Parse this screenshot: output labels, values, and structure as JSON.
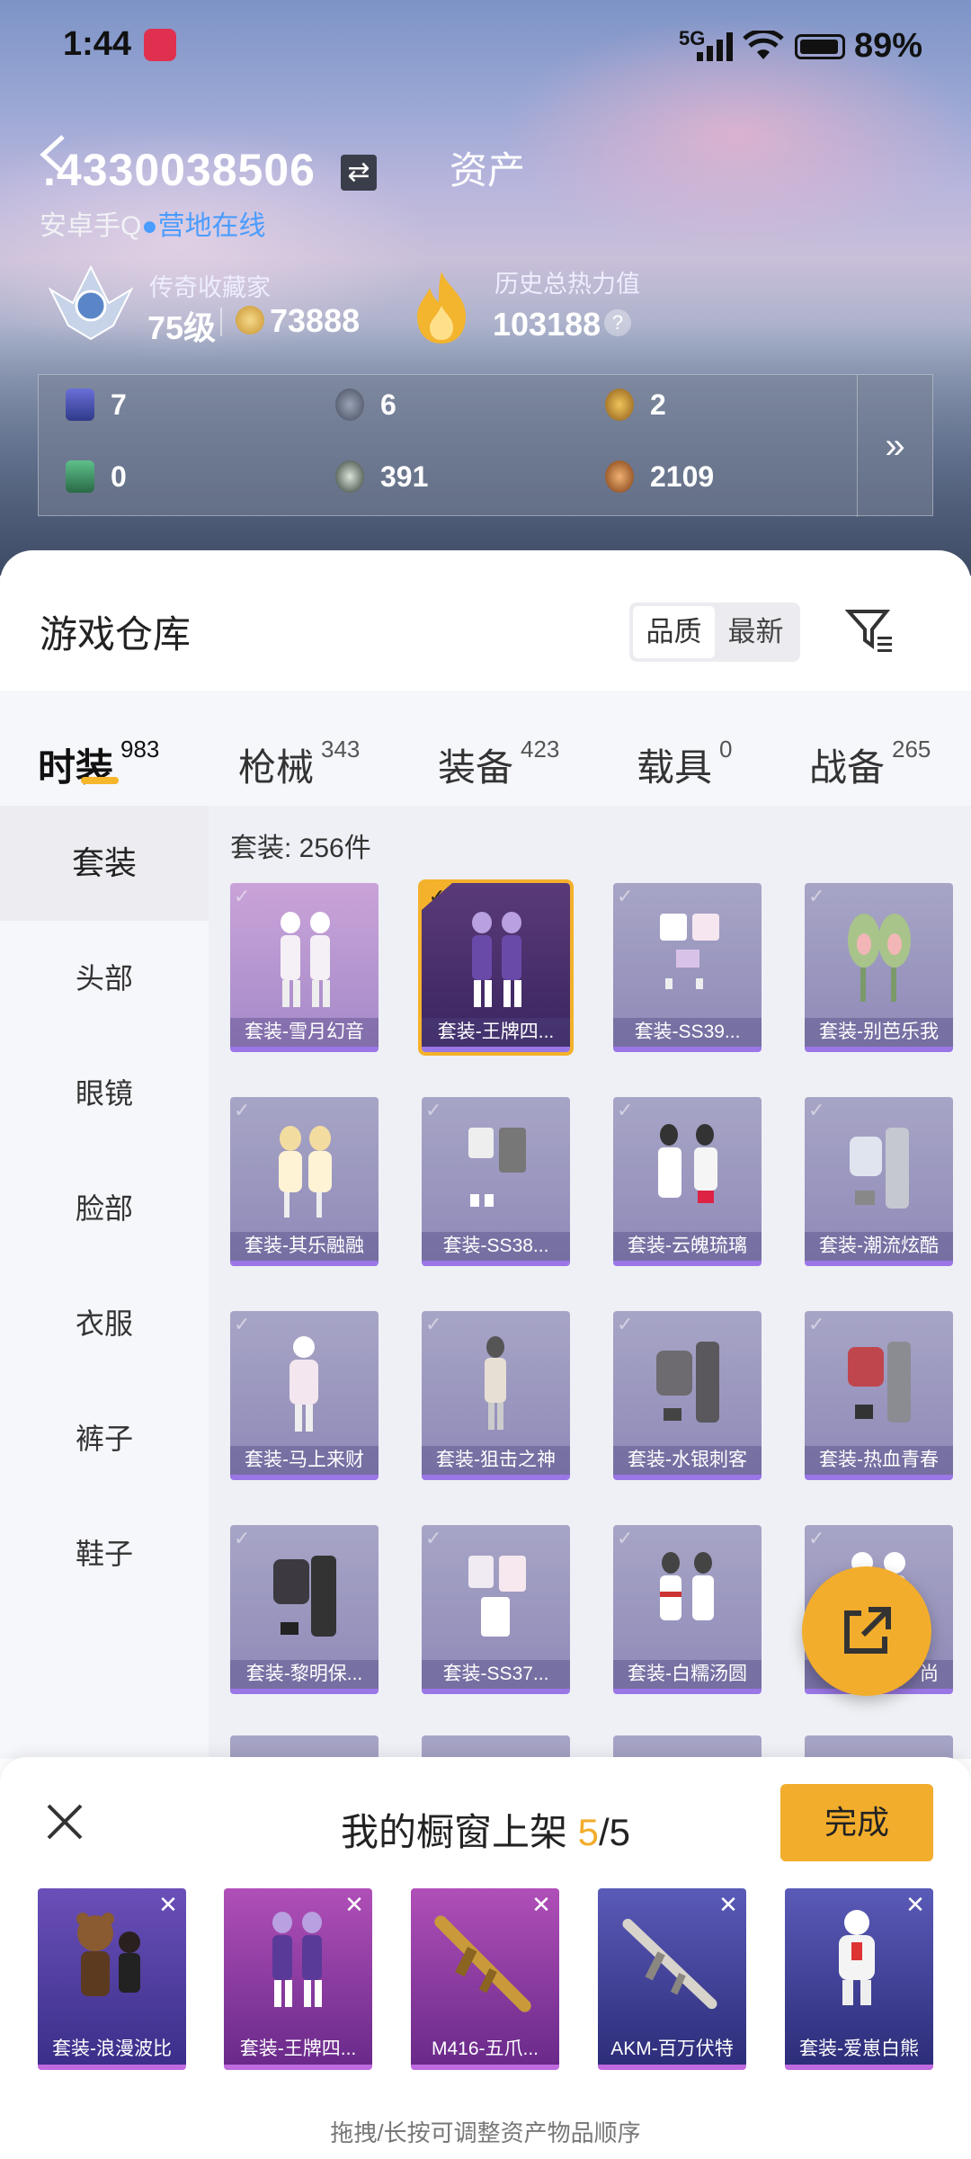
{
  "status": {
    "time": "1:44",
    "network": "5G",
    "battery": "89%"
  },
  "header": {
    "uid": ".4330038506",
    "swap_icon": "⇄",
    "title": "资产",
    "platform": "安卓手Q",
    "dot": "●",
    "online_status": "营地在线",
    "collector_label": "传奇收藏家",
    "level": "75级",
    "coins": "73888",
    "heat_label": "历史总热力值",
    "heat_value": "103188",
    "help": "?"
  },
  "stats": [
    {
      "icon": "card-icon",
      "value": "7"
    },
    {
      "icon": "s-coin-icon",
      "value": "6"
    },
    {
      "icon": "a-coin-icon",
      "value": "2"
    },
    {
      "icon": "ticket-icon",
      "value": "0"
    },
    {
      "icon": "orb-icon",
      "value": "391"
    },
    {
      "icon": "bronze-coin-icon",
      "value": "2109"
    }
  ],
  "stats_more": "»",
  "warehouse": {
    "title": "游戏仓库",
    "sort": {
      "selected": "品质",
      "other": "最新"
    }
  },
  "tabs": [
    {
      "label": "时装",
      "count": "983"
    },
    {
      "label": "枪械",
      "count": "343"
    },
    {
      "label": "装备",
      "count": "423"
    },
    {
      "label": "载具",
      "count": "0"
    },
    {
      "label": "战备",
      "count": "265"
    }
  ],
  "sidebar": [
    "套装",
    "头部",
    "眼镜",
    "脸部",
    "衣服",
    "裤子",
    "鞋子"
  ],
  "grid": {
    "count_label": "套装: 256件",
    "items": [
      "套装-雪月幻音",
      "套装-王牌四...",
      "套装-SS39...",
      "套装-别芭乐我",
      "套装-其乐融融",
      "套装-SS38...",
      "套装-云魄琉璃",
      "套装-潮流炫酷",
      "套装-马上来财",
      "套装-狙击之神",
      "套装-水银刺客",
      "套装-热血青春",
      "套装-黎明保...",
      "套装-SS37...",
      "套装-白糯汤圆",
      "尚"
    ]
  },
  "sheet": {
    "title_prefix": "我的橱窗上架 ",
    "selected": "5",
    "total": "/5",
    "done": "完成",
    "slots": [
      "套装-浪漫波比",
      "套装-王牌四...",
      "M416-五爪...",
      "AKM-百万伏特",
      "套装-爱崽白熊"
    ],
    "remove": "✕",
    "hint": "拖拽/长按可调整资产物品顺序"
  },
  "colors": {
    "accent": "#f2ad2c",
    "online": "#4a9cff"
  }
}
